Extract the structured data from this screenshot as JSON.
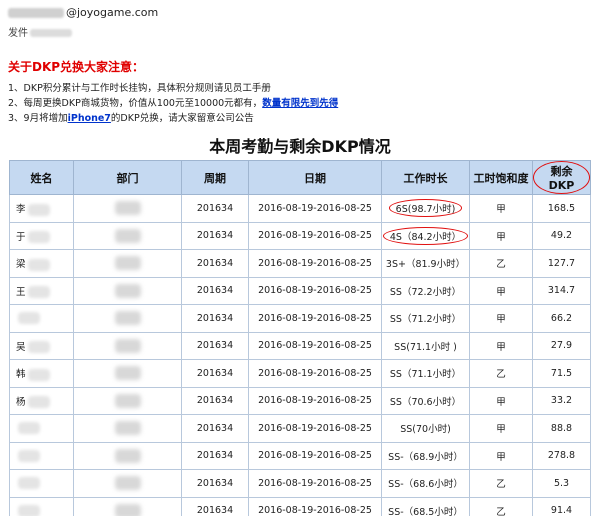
{
  "email": {
    "from_domain": "@joyogame.com",
    "sender_label": "发件"
  },
  "notice": {
    "title": "关于DKP兑换大家注意：",
    "item1": "1、DKP积分累计与工作时长挂钩，具体积分规则请见员工手册",
    "item2_prefix": "2、每周更换DKP商城货物，价值从100元至10000元都有，",
    "item2_link": "数量有限先到先得",
    "item3_prefix": "3、9月将增加",
    "item3_highlight": "iPhone7",
    "item3_suffix": "的DKP兑换，请大家留意公司公告"
  },
  "table": {
    "title": "本周考勤与剩余DKP情况",
    "headers": [
      "姓名",
      "部门",
      "周期",
      "日期",
      "工作时长",
      "工时饱和度",
      "剩余DKP"
    ],
    "rows": [
      {
        "name": "李",
        "period": "201634",
        "date": "2016-08-19-2016-08-25",
        "hours": "6S(98.7小时)",
        "sat": "甲",
        "dkp": "168.5"
      },
      {
        "name": "于",
        "period": "201634",
        "date": "2016-08-19-2016-08-25",
        "hours": "4S（84.2小时）",
        "sat": "甲",
        "dkp": "49.2"
      },
      {
        "name": "梁",
        "period": "201634",
        "date": "2016-08-19-2016-08-25",
        "hours": "3S+（81.9小时）",
        "sat": "乙",
        "dkp": "127.7"
      },
      {
        "name": "王",
        "period": "201634",
        "date": "2016-08-19-2016-08-25",
        "hours": "SS（72.2小时）",
        "sat": "甲",
        "dkp": "314.7"
      },
      {
        "name": "",
        "period": "201634",
        "date": "2016-08-19-2016-08-25",
        "hours": "SS（71.2小时）",
        "sat": "甲",
        "dkp": "66.2"
      },
      {
        "name": "吴",
        "period": "201634",
        "date": "2016-08-19-2016-08-25",
        "hours": "SS(71.1小时 )",
        "sat": "甲",
        "dkp": "27.9"
      },
      {
        "name": "韩",
        "period": "201634",
        "date": "2016-08-19-2016-08-25",
        "hours": "SS（71.1小时）",
        "sat": "乙",
        "dkp": "71.5"
      },
      {
        "name": "杨",
        "period": "201634",
        "date": "2016-08-19-2016-08-25",
        "hours": "SS（70.6小时）",
        "sat": "甲",
        "dkp": "33.2"
      },
      {
        "name": "",
        "period": "201634",
        "date": "2016-08-19-2016-08-25",
        "hours": "SS(70小时)",
        "sat": "甲",
        "dkp": "88.8"
      },
      {
        "name": "",
        "period": "201634",
        "date": "2016-08-19-2016-08-25",
        "hours": "SS-（68.9小时）",
        "sat": "甲",
        "dkp": "278.8"
      },
      {
        "name": "",
        "period": "201634",
        "date": "2016-08-19-2016-08-25",
        "hours": "SS-（68.6小时）",
        "sat": "乙",
        "dkp": "5.3"
      },
      {
        "name": "",
        "period": "201634",
        "date": "2016-08-19-2016-08-25",
        "hours": "SS-（68.5小时）",
        "sat": "乙",
        "dkp": "91.4"
      }
    ]
  },
  "colors": {
    "header_bg": "#c5d9f1",
    "notice_title": "#e00000",
    "link": "#0033cc",
    "circle": "#e01010"
  }
}
